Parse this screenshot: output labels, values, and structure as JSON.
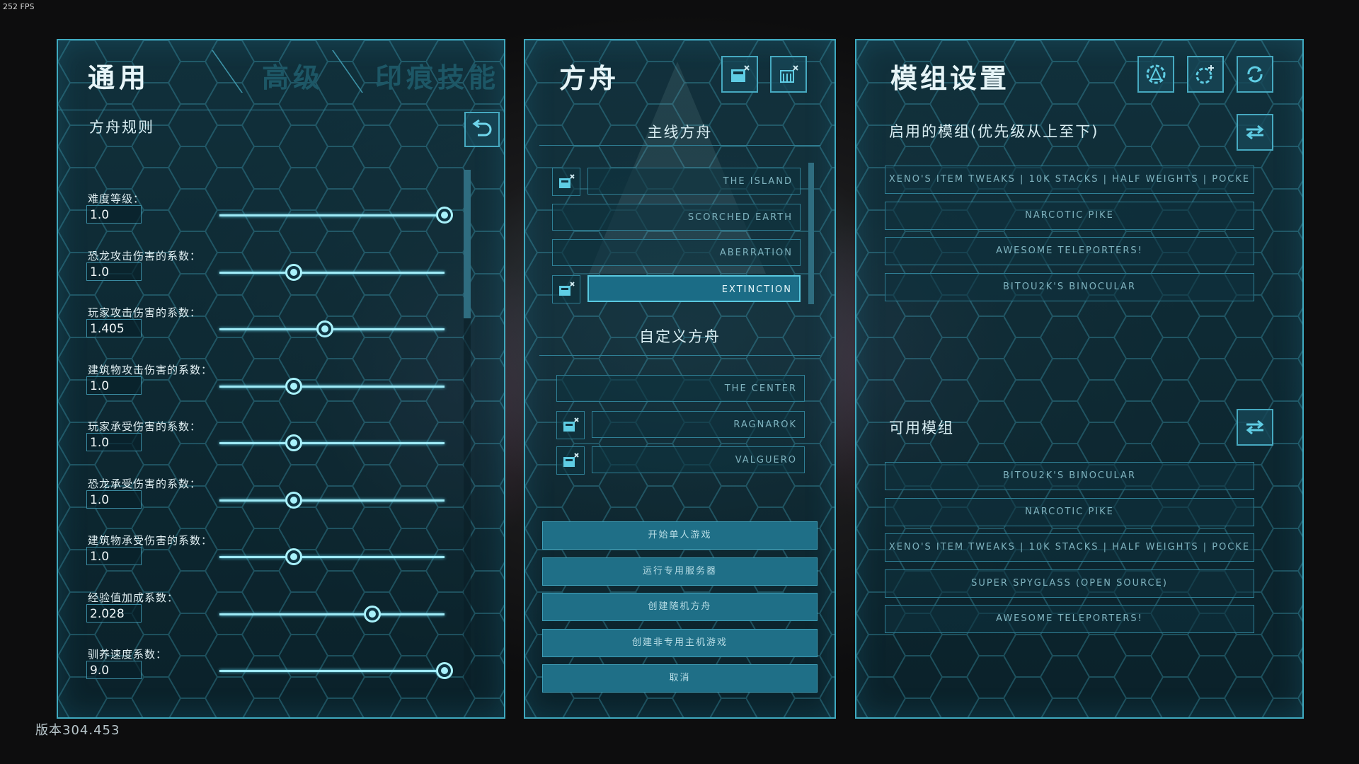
{
  "overlay": {
    "fps": "252 FPS",
    "version": "版本304.453"
  },
  "left_panel": {
    "tabs": [
      "通用",
      "高级",
      "印痕技能"
    ],
    "section_title": "方舟规则",
    "settings": [
      {
        "label": "难度等级：",
        "value": "1.0",
        "level": 1.0
      },
      {
        "label": "恐龙攻击伤害的系数：",
        "value": "1.0",
        "level": 0.33
      },
      {
        "label": "玩家攻击伤害的系数：",
        "value": "1.405",
        "level": 0.47
      },
      {
        "label": "建筑物攻击伤害的系数：",
        "value": "1.0",
        "level": 0.33
      },
      {
        "label": "玩家承受伤害的系数：",
        "value": "1.0",
        "level": 0.33
      },
      {
        "label": "恐龙承受伤害的系数：",
        "value": "1.0",
        "level": 0.33
      },
      {
        "label": "建筑物承受伤害的系数：",
        "value": "1.0",
        "level": 0.33
      },
      {
        "label": "经验值加成系数：",
        "value": "2.028",
        "level": 0.68
      },
      {
        "label": "驯养速度系数：",
        "value": "9.0",
        "level": 1.0
      }
    ]
  },
  "middle_panel": {
    "title": "方舟",
    "main_section": "主线方舟",
    "main_maps": [
      {
        "name": "THE ISLAND",
        "icon": true,
        "selected": false
      },
      {
        "name": "SCORCHED EARTH",
        "icon": false,
        "selected": false
      },
      {
        "name": "ABERRATION",
        "icon": false,
        "selected": false
      },
      {
        "name": "EXTINCTION",
        "icon": true,
        "selected": true
      }
    ],
    "custom_section": "自定义方舟",
    "custom_maps": [
      {
        "name": "THE CENTER",
        "icon": false
      },
      {
        "name": "RAGNAROK",
        "icon": true
      },
      {
        "name": "VALGUERO",
        "icon": true
      }
    ],
    "actions": [
      "开始单人游戏",
      "运行专用服务器",
      "创建随机方舟",
      "创建非专用主机游戏",
      "取消"
    ]
  },
  "right_panel": {
    "title": "模组设置",
    "enabled_title": "启用的模组(优先级从上至下)",
    "enabled_mods": [
      "XENO'S ITEM TWEAKS | 10K STACKS | HALF WEIGHTS | POCKE",
      "NARCOTIC PIKE",
      "AWESOME TELEPORTERS!",
      "BITOU2K'S BINOCULAR"
    ],
    "available_title": "可用模组",
    "available_mods": [
      "BITOU2K'S BINOCULAR",
      "NARCOTIC PIKE",
      "XENO'S ITEM TWEAKS | 10K STACKS | HALF WEIGHTS | POCKE",
      "SUPER SPYGLASS (OPEN SOURCE)",
      "AWESOME TELEPORTERS!"
    ]
  },
  "colors": {
    "accent": "#3fa9bf",
    "track": "#9feaf6",
    "selected": "#1b6c86",
    "action": "#1f6f87"
  }
}
